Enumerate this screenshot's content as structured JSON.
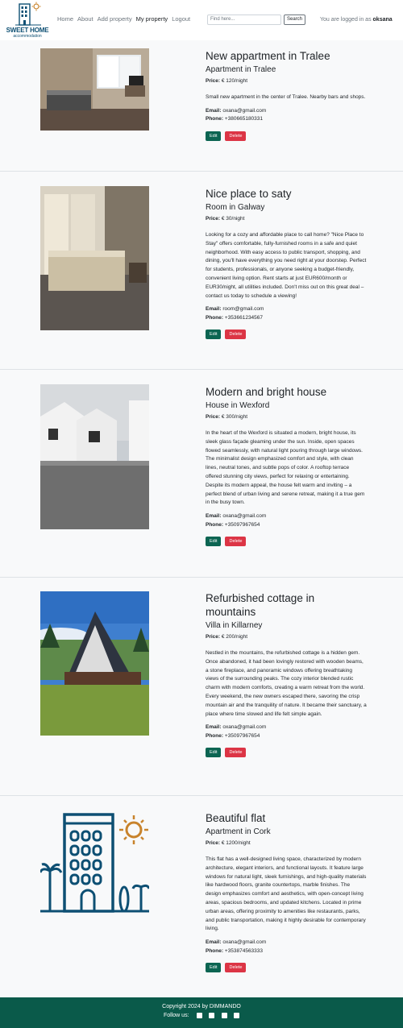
{
  "brand": {
    "name": "SWEET HOME",
    "sub": "accommodation"
  },
  "nav": {
    "links": [
      {
        "label": "Home",
        "active": false
      },
      {
        "label": "About",
        "active": false
      },
      {
        "label": "Add property",
        "active": false
      },
      {
        "label": "My property",
        "active": true
      },
      {
        "label": "Logout",
        "active": false
      }
    ],
    "search_placeholder": "Find here...",
    "search_button": "Search",
    "logged_prefix": "You are logged in as",
    "username": "oksana"
  },
  "labels": {
    "price": "Price:",
    "email": "Email:",
    "phone": "Phone:",
    "edit": "Edit",
    "delete": "Delete"
  },
  "listings": [
    {
      "title": "New appartment in Tralee",
      "subtitle": "Apartment in Tralee",
      "price": "€ 120/night",
      "description": "Small new apartment in the center of Tralee. Nearby bars and shops.",
      "email": "oxana@gmail.com",
      "phone": "+380665180331"
    },
    {
      "title": "Nice place to saty",
      "subtitle": "Room in Galway",
      "price": "€ 30/night",
      "description": "Looking for a cozy and affordable place to call home? \"Nice Place to Stay\" offers comfortable, fully-furnished rooms in a safe and quiet neighborhood. With easy access to public transport, shopping, and dining, you'll have everything you need right at your doorstep. Perfect for students, professionals, or anyone seeking a budget-friendly, convenient living option. Rent starts at just EUR600/month or EUR30/night, all utilities included. Don't miss out on this great deal – contact us today to schedule a viewing!",
      "email": "room@gmail.com",
      "phone": "+353661234567"
    },
    {
      "title": "Modern and bright house",
      "subtitle": "House in Wexford",
      "price": "€ 300/night",
      "description": "In the heart of the Wexford is situated a modern, bright house, its sleek glass façade gleaming under the sun. Inside, open spaces flowed seamlessly, with natural light pouring through large windows. The minimalist design emphasized comfort and style, with clean lines, neutral tones, and subtle pops of color. A rooftop terrace offered stunning city views, perfect for relaxing or entertaining. Despite its modern appeal, the house felt warm and inviting – a perfect blend of urban living and serene retreat, making it a true gem in the busy town.",
      "email": "oxana@gmail.com",
      "phone": "+35097967654"
    },
    {
      "title": "Refurbished cottage in mountains",
      "subtitle": "Villa in Killarney",
      "price": "€ 200/night",
      "description": "Nestled in the mountains, the refurbished cottage is a hidden gem. Once abandoned, it had been lovingly restored with wooden beams, a stone fireplace, and panoramic windows offering breathtaking views of the surrounding peaks. The cozy interior blended rustic charm with modern comforts, creating a warm retreat from the world. Every weekend, the new owners escaped there, savoring the crisp mountain air and the tranquility of nature. It became their sanctuary, a place where time slowed and life felt simple again.",
      "email": "oxana@gmail.com",
      "phone": "+35097967654"
    },
    {
      "title": "Beautiful flat",
      "subtitle": "Apartment in Cork",
      "price": "€ 1200/night",
      "description": "This flat has a well-designed living space, characterized by modern architecture, elegant interiors, and functional layouts. It feature large windows for natural light, sleek furnishings, and high-quality materials like hardwood floors, granite countertops, marble finishes. The design emphasizes comfort and aesthetics, with open-concept living areas, spacious bedrooms, and updated kitchens. Located in prime urban areas, offering proximity to amenities like restaurants, parks, and public transportation, making it highly desirable for contemporary living.",
      "email": "oxana@gmail.com",
      "phone": "+353874563333"
    }
  ],
  "footer": {
    "copyright": "Copyright 2024 by DIMMANDO",
    "follow": "Follow us:",
    "icons": [
      "facebook-icon",
      "twitter-icon",
      "instagram-icon",
      "youtube-icon"
    ]
  },
  "colors": {
    "brand": "#0d4f73",
    "sun": "#c8832c",
    "edit": "#0c6552",
    "delete": "#dc3545",
    "footer": "#0a5a4a"
  }
}
